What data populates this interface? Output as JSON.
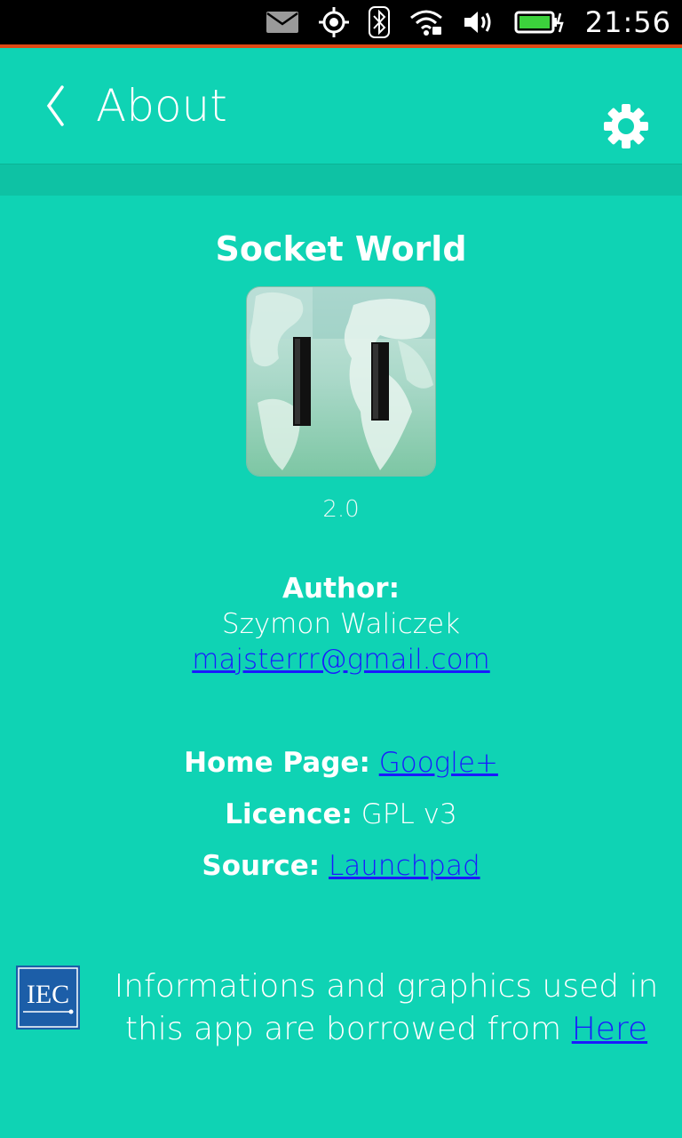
{
  "status_bar": {
    "time": "21:56",
    "icons": [
      "mail-icon",
      "location-icon",
      "bluetooth-icon",
      "wifi-icon",
      "volume-icon",
      "battery-charging-icon"
    ],
    "accent_color": "#dd4814"
  },
  "header": {
    "title": "About",
    "back_icon": "chevron-left-icon",
    "settings_icon": "gear-icon"
  },
  "app": {
    "name": "Socket World",
    "version": "2.0",
    "icon": "socket-world-app-icon"
  },
  "author": {
    "label": "Author:",
    "name": "Szymon Waliczek",
    "email": "majsterrr@gmail.com"
  },
  "details": {
    "home_page_label": "Home Page:",
    "home_page_link": "Google+",
    "licence_label": "Licence:",
    "licence_value": "GPL v3",
    "source_label": "Source:",
    "source_link": "Launchpad"
  },
  "footer": {
    "logo_text": "IEC",
    "text_line1": "Informations and graphics used in",
    "text_line2": "this app are borrowed from",
    "link": "Here"
  },
  "colors": {
    "background": "#0fd3b4",
    "link": "#1a1aff",
    "iec_blue": "#1c5ea8"
  }
}
